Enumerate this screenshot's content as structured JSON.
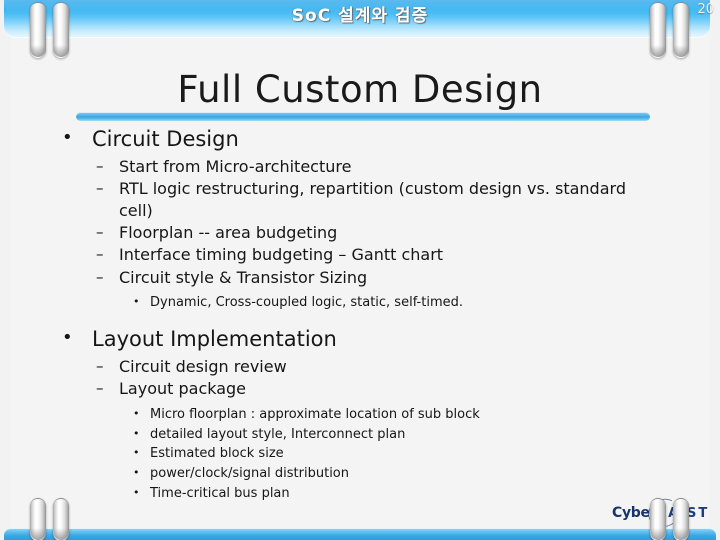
{
  "header": {
    "title": "SoC 설계와 검증",
    "page_number": "20"
  },
  "title": {
    "text": "Full Custom Design"
  },
  "bullets": [
    {
      "level": 1,
      "marker": "•",
      "text": "Circuit Design"
    },
    {
      "level": 2,
      "marker": "–",
      "text": "Start from Micro-architecture"
    },
    {
      "level": 2,
      "marker": "–",
      "text": "RTL logic restructuring, repartition (custom design vs. standard cell)"
    },
    {
      "level": 2,
      "marker": "–",
      "text": "Floorplan  -- area budgeting"
    },
    {
      "level": 2,
      "marker": "–",
      "text": "Interface timing budgeting – Gantt chart"
    },
    {
      "level": 2,
      "marker": "–",
      "text": "Circuit style & Transistor Sizing"
    },
    {
      "level": 3,
      "marker": "•",
      "text": "Dynamic, Cross-coupled logic, static, self-timed."
    },
    {
      "level": 1,
      "marker": "•",
      "text": "Layout Implementation"
    },
    {
      "level": 2,
      "marker": "–",
      "text": "Circuit design review"
    },
    {
      "level": 2,
      "marker": "–",
      "text": "Layout package"
    },
    {
      "level": 3,
      "marker": "•",
      "text": "Micro floorplan : approximate location of sub block"
    },
    {
      "level": 3,
      "marker": "•",
      "text": "detailed layout style, Interconnect plan"
    },
    {
      "level": 3,
      "marker": "•",
      "text": "Estimated block size"
    },
    {
      "level": 3,
      "marker": "•",
      "text": "power/clock/signal distribution"
    },
    {
      "level": 3,
      "marker": "•",
      "text": "Time-critical bus plan"
    }
  ],
  "logo": {
    "cyber": "Cyber",
    "kaist": "KAIST"
  },
  "colors": {
    "header_blue": "#2fb0f0",
    "rule_blue": "#3ea5e0",
    "footer_blue": "#37a7e4",
    "background": "#f2f2f2",
    "page": "#f4f4f4",
    "text": "#161616",
    "logo_navy": "#16356b"
  }
}
